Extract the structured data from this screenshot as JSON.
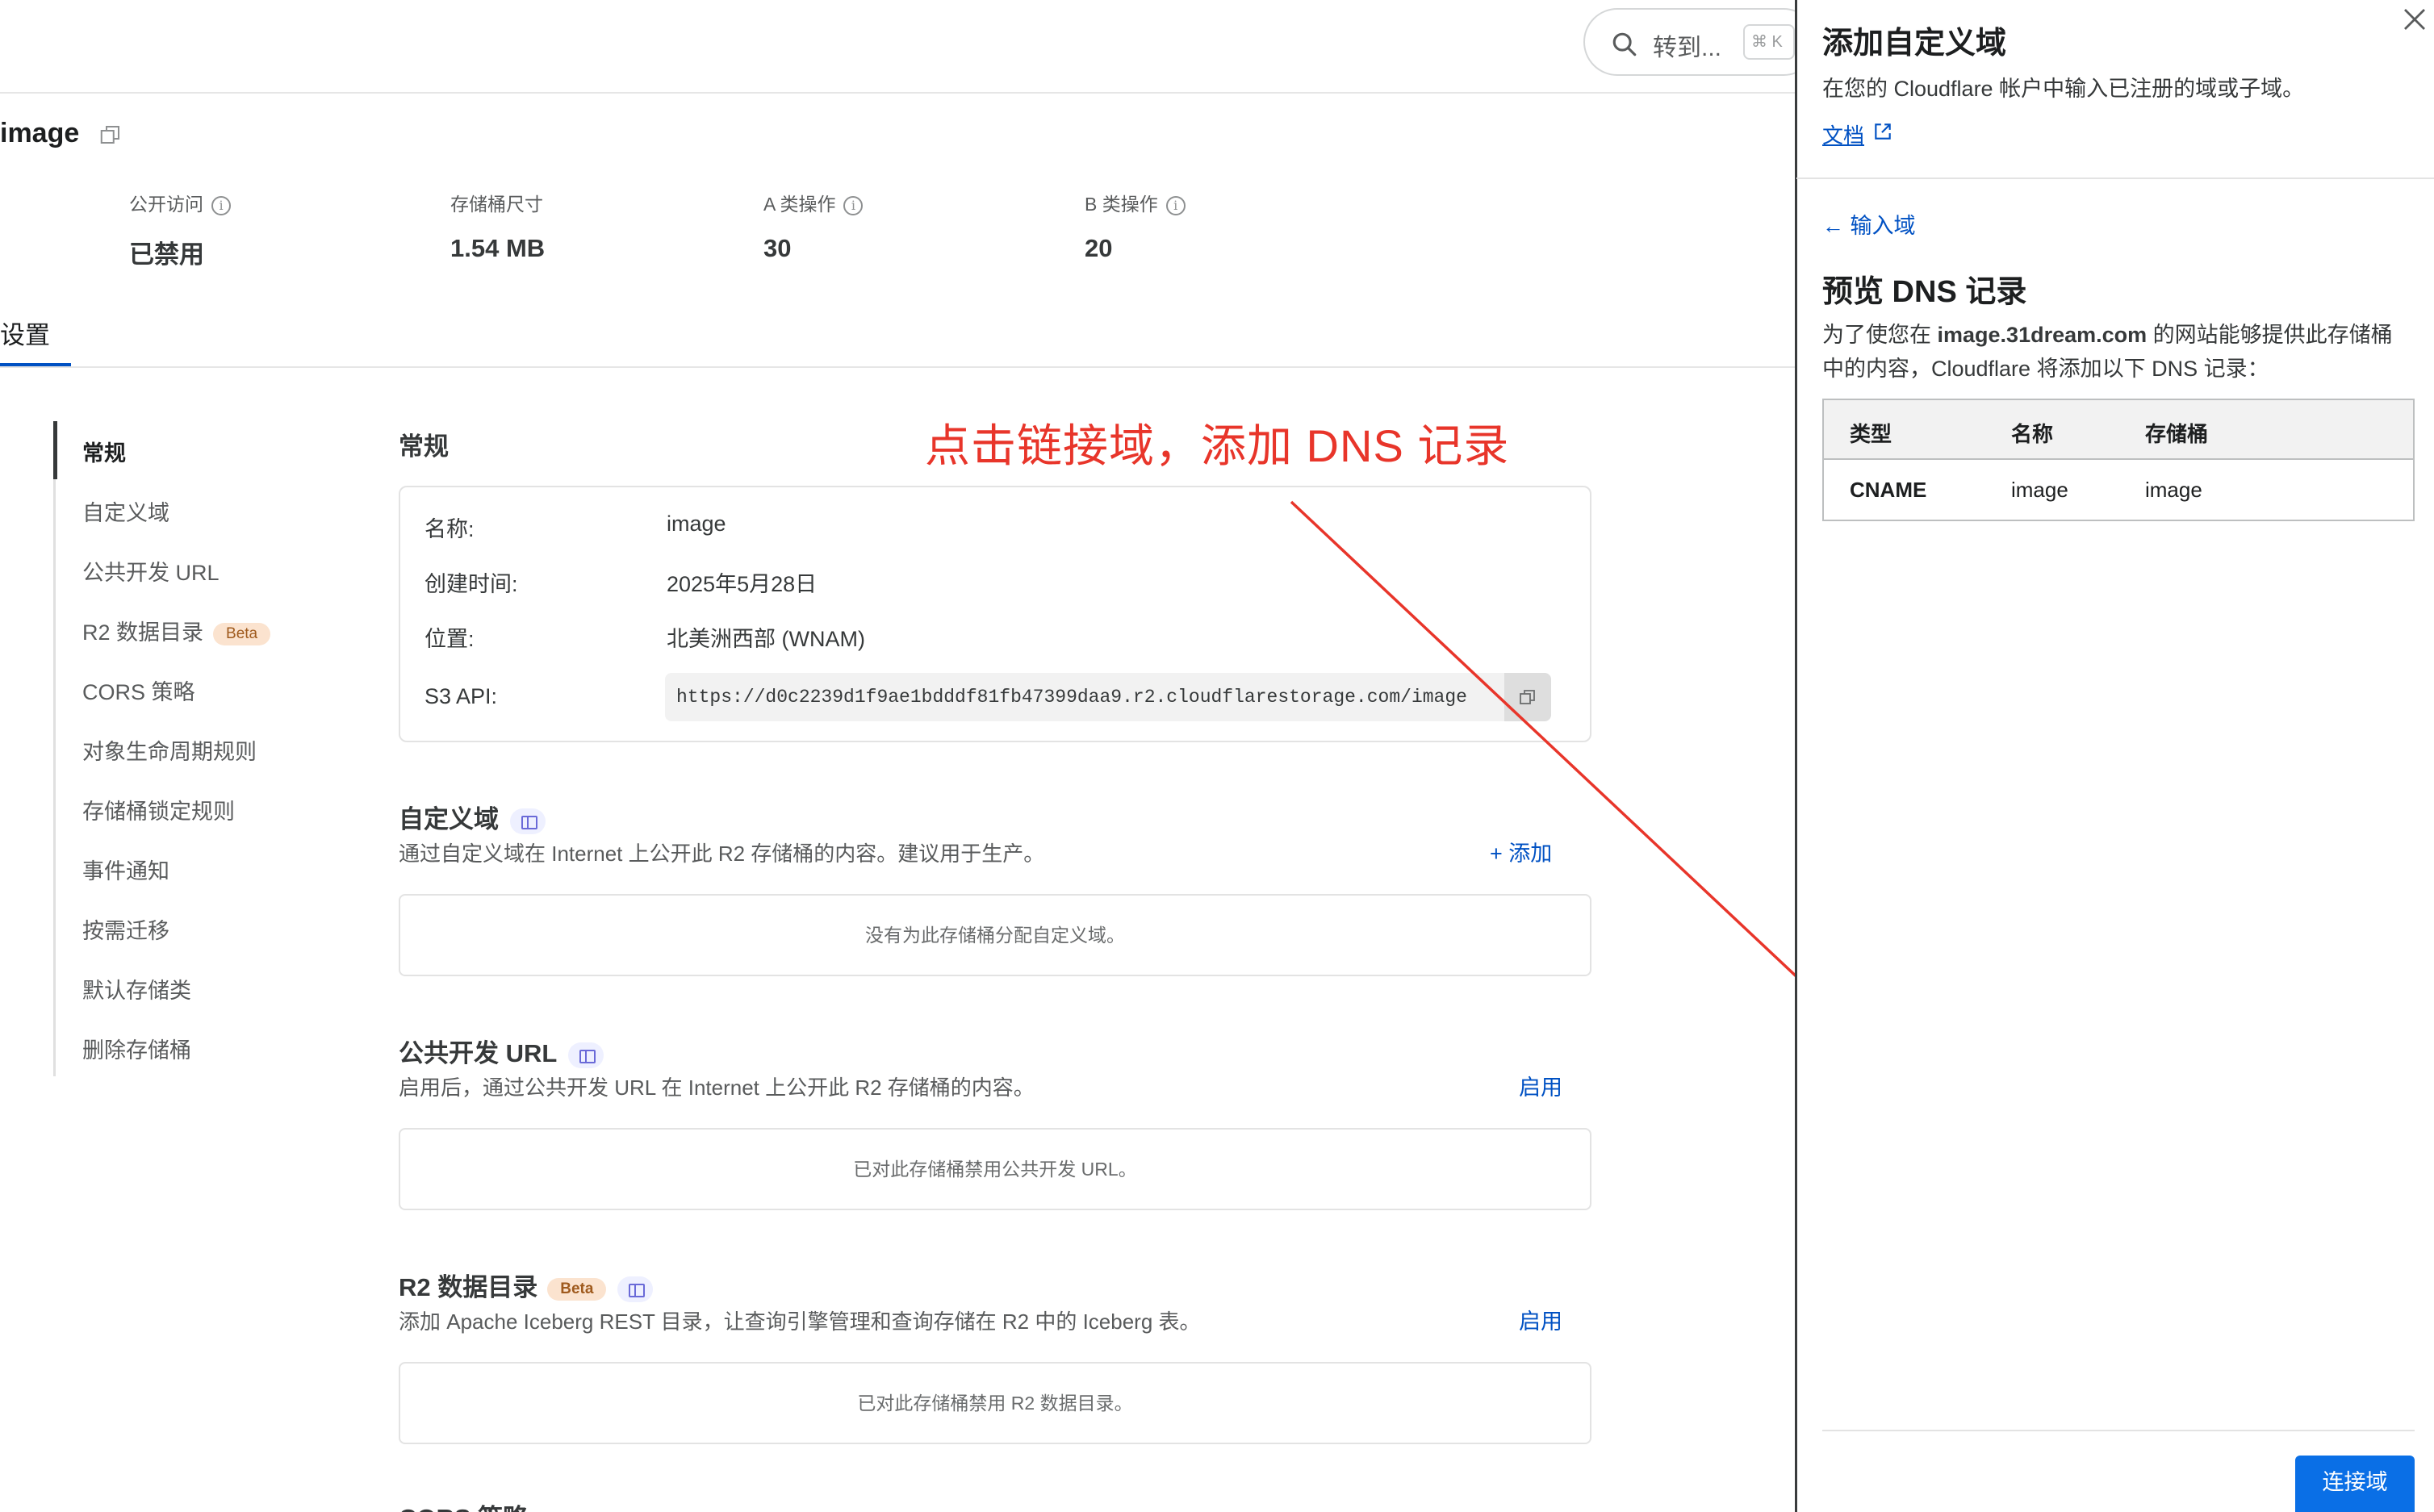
{
  "header": {
    "search_placeholder": "转到...",
    "search_shortcut": "⌘ K"
  },
  "bucket": {
    "title": "image",
    "stats": [
      {
        "label": "公开访问",
        "value": "已禁用"
      },
      {
        "label": "存储桶尺寸",
        "value": "1.54 MB"
      },
      {
        "label": "A 类操作",
        "value": "30"
      },
      {
        "label": "B 类操作",
        "value": "20"
      }
    ],
    "tab": "设置"
  },
  "nav": {
    "items": [
      "常规",
      "自定义域",
      "公共开发 URL",
      "R2 数据目录",
      "CORS 策略",
      "对象生命周期规则",
      "存储桶锁定规则",
      "事件通知",
      "按需迁移",
      "默认存储类",
      "删除存储桶"
    ],
    "beta": "Beta"
  },
  "general": {
    "title": "常规",
    "fields": [
      {
        "label": "名称:",
        "value": "image"
      },
      {
        "label": "创建时间:",
        "value": "2025年5月28日"
      },
      {
        "label": "位置:",
        "value": "北美洲西部 (WNAM)"
      },
      {
        "label": "S3 API:",
        "value": "https://d0c2239d1f9ae1bdddf81fb47399daa9.r2.cloudflarestorage.com/image"
      }
    ]
  },
  "custom_domain": {
    "title": "自定义域",
    "desc": "通过自定义域在 Internet 上公开此 R2 存储桶的内容。建议用于生产。",
    "action": "+ 添加",
    "empty": "没有为此存储桶分配自定义域。"
  },
  "public_url": {
    "title": "公共开发 URL",
    "desc": "启用后，通过公共开发 URL 在 Internet 上公开此 R2 存储桶的内容。",
    "action": "启用",
    "empty": "已对此存储桶禁用公共开发 URL。"
  },
  "r2_catalog": {
    "title": "R2 数据目录",
    "beta": "Beta",
    "desc": "添加 Apache Iceberg REST 目录，让查询引擎管理和查询存储在 R2 中的 Iceberg 表。",
    "action": "启用",
    "empty": "已对此存储桶禁用 R2 数据目录。"
  },
  "cors": {
    "title": "CORS 策略"
  },
  "annotation": {
    "text": "点击链接域，添加 DNS 记录",
    "color": "#e8352a"
  },
  "panel": {
    "title": "添加自定义域",
    "subtitle": "在您的 Cloudflare 帐户中输入已注册的域或子域。",
    "doc_link": "文档",
    "back": "← 输入域",
    "preview_title": "预览 DNS 记录",
    "para_prefix": "为了使您在 ",
    "para_domain": "image.31dream.com",
    "para_suffix": " 的网站能够提供此存储桶中的内容，Cloudflare 将添加以下 DNS 记录：",
    "table": {
      "headers": [
        "类型",
        "名称",
        "存储桶"
      ],
      "row": [
        "CNAME",
        "image",
        "image"
      ]
    },
    "connect_button": "连接域"
  },
  "colors": {
    "accent": "#0051c3",
    "button": "#0a6fe6",
    "annotation": "#e8352a"
  }
}
